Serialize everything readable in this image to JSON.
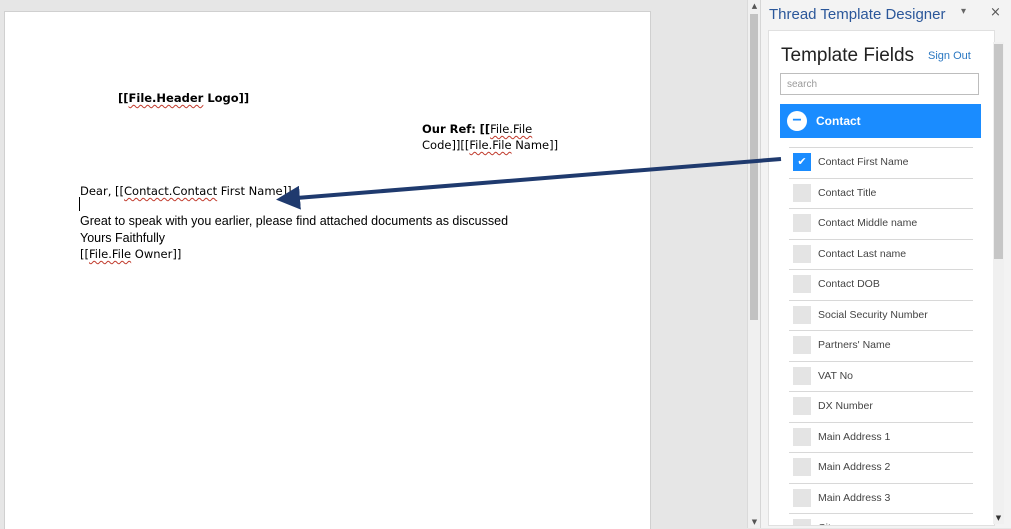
{
  "document": {
    "header_logo": "[[File.Header Logo]]",
    "our_ref_label": "Our Ref:",
    "our_ref_value1": "[[File.File",
    "our_ref_value2": "Code]][[File.File Name]]",
    "greeting_prefix": "Dear, ",
    "greeting_field": "[[Contact.Contact First Name]]",
    "body_line": "Great to speak with you earlier, please find attached documents as discussed",
    "closing": "Yours Faithfully",
    "owner_field": "[[File.File Owner]]"
  },
  "pane": {
    "title": "Thread Template Designer",
    "menu_glyph": "▾",
    "close_glyph": "×"
  },
  "addin": {
    "heading": "Template Fields",
    "sign_out": "Sign Out",
    "search_placeholder": "search",
    "group_label": "Contact",
    "group_icon": "−",
    "fields": [
      {
        "label": "Contact First Name",
        "checked": true
      },
      {
        "label": "Contact Title",
        "checked": false
      },
      {
        "label": "Contact Middle name",
        "checked": false
      },
      {
        "label": "Contact Last name",
        "checked": false
      },
      {
        "label": "Contact DOB",
        "checked": false
      },
      {
        "label": "Social Security Number",
        "checked": false
      },
      {
        "label": "Partners' Name",
        "checked": false
      },
      {
        "label": "VAT No",
        "checked": false
      },
      {
        "label": "DX Number",
        "checked": false
      },
      {
        "label": "Main Address 1",
        "checked": false
      },
      {
        "label": "Main Address 2",
        "checked": false
      },
      {
        "label": "Main Address 3",
        "checked": false
      },
      {
        "label": "City",
        "checked": false
      }
    ]
  },
  "colors": {
    "accent": "#1a8cff",
    "pane_title": "#2b579a",
    "arrow": "#1f3a6e"
  },
  "icons": {
    "checkbox_checked": "checkmark-icon",
    "group_toggle": "collapse-minus-icon",
    "pane_menu": "chevron-down-icon",
    "pane_close": "close-icon"
  }
}
